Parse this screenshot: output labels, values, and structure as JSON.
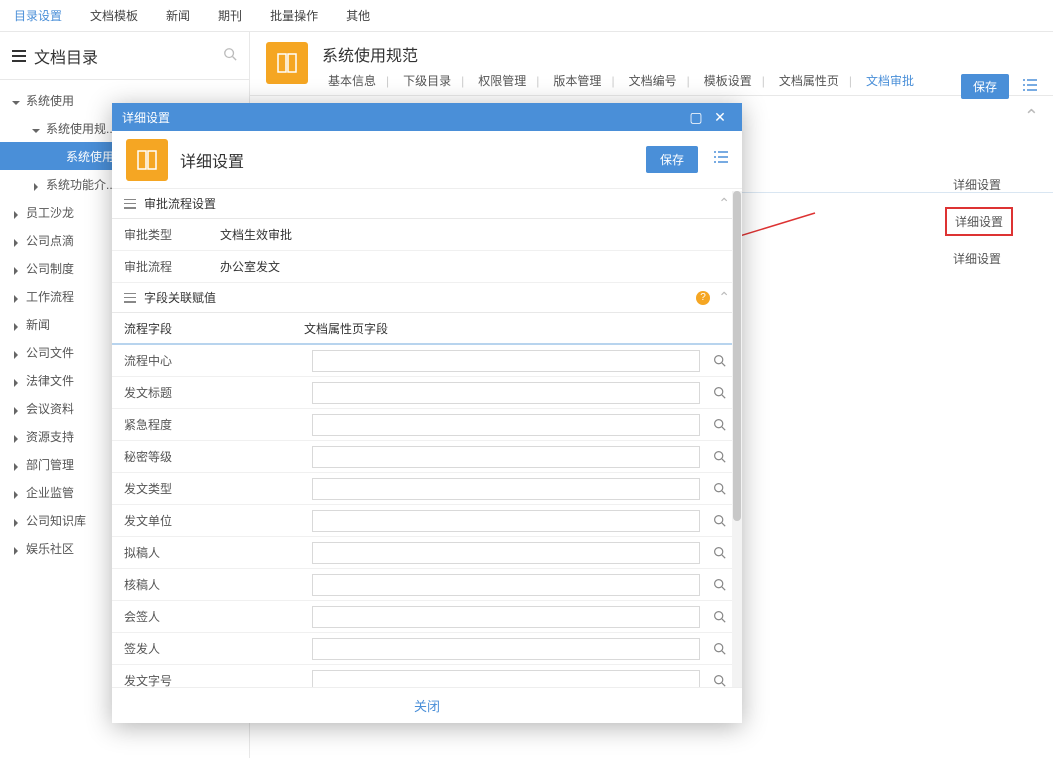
{
  "top_menu": {
    "items": [
      "目录设置",
      "文档模板",
      "新闻",
      "期刊",
      "批量操作",
      "其他"
    ],
    "active": 0
  },
  "sidebar": {
    "title": "文档目录",
    "tree": [
      {
        "lvl": 1,
        "caret": "down",
        "label": "系统使用"
      },
      {
        "lvl": 2,
        "caret": "down",
        "label": "系统使用规..."
      },
      {
        "lvl": 3,
        "caret": "",
        "label": "系统使用",
        "sel": true
      },
      {
        "lvl": 2,
        "caret": "right",
        "label": "系统功能介..."
      },
      {
        "lvl": 1,
        "caret": "right",
        "label": "员工沙龙"
      },
      {
        "lvl": 1,
        "caret": "right",
        "label": "公司点滴"
      },
      {
        "lvl": 1,
        "caret": "right",
        "label": "公司制度"
      },
      {
        "lvl": 1,
        "caret": "right",
        "label": "工作流程"
      },
      {
        "lvl": 1,
        "caret": "right",
        "label": "新闻"
      },
      {
        "lvl": 1,
        "caret": "right",
        "label": "公司文件"
      },
      {
        "lvl": 1,
        "caret": "right",
        "label": "法律文件"
      },
      {
        "lvl": 1,
        "caret": "right",
        "label": "会议资料"
      },
      {
        "lvl": 1,
        "caret": "right",
        "label": "资源支持"
      },
      {
        "lvl": 1,
        "caret": "right",
        "label": "部门管理"
      },
      {
        "lvl": 1,
        "caret": "right",
        "label": "企业监管"
      },
      {
        "lvl": 1,
        "caret": "right",
        "label": "公司知识库"
      },
      {
        "lvl": 1,
        "caret": "right",
        "label": "娱乐社区"
      }
    ]
  },
  "doc": {
    "title": "系统使用规范",
    "tabs": [
      "基本信息",
      "下级目录",
      "权限管理",
      "版本管理",
      "文档编号",
      "模板设置",
      "文档属性页",
      "文档审批"
    ],
    "active_tab": 7,
    "save": "保存"
  },
  "detail_links": {
    "items": [
      "详细设置",
      "详细设置",
      "详细设置"
    ],
    "highlight_index": 1
  },
  "modal": {
    "titlebar": "详细设置",
    "header_title": "详细设置",
    "save": "保存",
    "section1": {
      "title": "审批流程设置",
      "rows": [
        {
          "label": "审批类型",
          "value": "文档生效审批"
        },
        {
          "label": "审批流程",
          "value": "办公室发文"
        }
      ]
    },
    "section2": {
      "title": "字段关联赋值",
      "col_a": "流程字段",
      "col_b": "文档属性页字段",
      "fields": [
        "流程中心",
        "发文标题",
        "紧急程度",
        "秘密等级",
        "发文类型",
        "发文单位",
        "拟稿人",
        "核稿人",
        "会签人",
        "签发人",
        "发文字号"
      ]
    },
    "close": "关闭"
  }
}
